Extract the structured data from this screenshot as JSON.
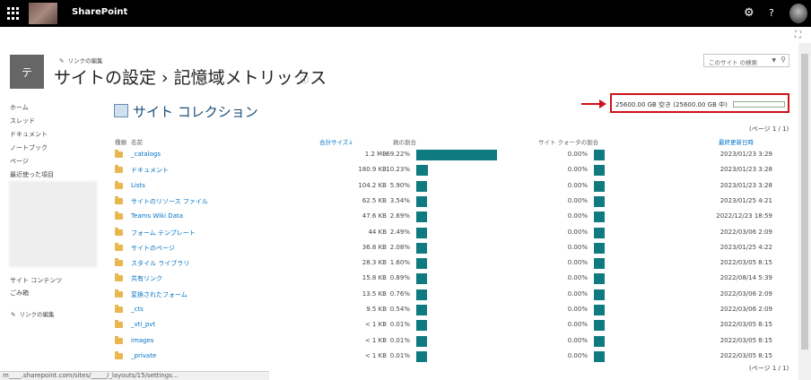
{
  "suitebar": {
    "app_title": "SharePoint",
    "icons": [
      "waffle-icon",
      "gear-icon",
      "help-icon",
      "avatar"
    ]
  },
  "header": {
    "edit_links_label": "リンクの編集",
    "logo_letter": "テ",
    "page_title": "サイトの設定 › 記憶域メトリックス",
    "search_placeholder": "このサイト の検索"
  },
  "nav": {
    "items": [
      "ホーム",
      "スレッド",
      "ドキュメント",
      "ノートブック",
      "ページ",
      "最近使った項目"
    ],
    "bottom_items": [
      "サイト コンテンツ",
      "ごみ箱"
    ],
    "edit_links_label": "リンクの編集"
  },
  "section": {
    "title": "サイト コレクション"
  },
  "quota": {
    "text": "25600.00 GB 空き (25600.00 GB 中)",
    "used_fraction": 0.0
  },
  "pager": {
    "text": "(ページ 1 / 1)"
  },
  "columns": {
    "type": "種類",
    "name": "名前",
    "total_size": "合計サイズ↓",
    "parent_pct": "親の割合",
    "quota_pct": "サイト クォータの割合",
    "modified": "最終更新日時"
  },
  "rows": [
    {
      "name": "_catalogs",
      "size": "1.2 MB",
      "pct": "69.22%",
      "pct_value": 69.22,
      "quota": "0.00%",
      "date": "2023/01/23 3:29"
    },
    {
      "name": "ドキュメント",
      "size": "180.9 KB",
      "pct": "10.23%",
      "pct_value": 10.23,
      "quota": "0.00%",
      "date": "2023/01/23 3:28"
    },
    {
      "name": "Lists",
      "size": "104.2 KB",
      "pct": "5.90%",
      "pct_value": 5.9,
      "quota": "0.00%",
      "date": "2023/01/23 3:28"
    },
    {
      "name": "サイトのリソース ファイル",
      "size": "62.5 KB",
      "pct": "3.54%",
      "pct_value": 3.54,
      "quota": "0.00%",
      "date": "2023/01/25 4:21"
    },
    {
      "name": "Teams Wiki Data",
      "size": "47.6 KB",
      "pct": "2.69%",
      "pct_value": 2.69,
      "quota": "0.00%",
      "date": "2022/12/23 18:59"
    },
    {
      "name": "フォーム テンプレート",
      "size": "44 KB",
      "pct": "2.49%",
      "pct_value": 2.49,
      "quota": "0.00%",
      "date": "2022/03/06 2:09"
    },
    {
      "name": "サイトのページ",
      "size": "36.8 KB",
      "pct": "2.08%",
      "pct_value": 2.08,
      "quota": "0.00%",
      "date": "2023/01/25 4:22"
    },
    {
      "name": "スタイル ライブラリ",
      "size": "28.3 KB",
      "pct": "1.60%",
      "pct_value": 1.6,
      "quota": "0.00%",
      "date": "2022/03/05 8:15"
    },
    {
      "name": "共有リンク",
      "size": "15.8 KB",
      "pct": "0.89%",
      "pct_value": 0.89,
      "quota": "0.00%",
      "date": "2022/08/14 5:39"
    },
    {
      "name": "変換されたフォーム",
      "size": "13.5 KB",
      "pct": "0.76%",
      "pct_value": 0.76,
      "quota": "0.00%",
      "date": "2022/03/06 2:09"
    },
    {
      "name": "_cts",
      "size": "9.5 KB",
      "pct": "0.54%",
      "pct_value": 0.54,
      "quota": "0.00%",
      "date": "2022/03/06 2:09"
    },
    {
      "name": "_vti_pvt",
      "size": "< 1 KB",
      "pct": "0.01%",
      "pct_value": 0.01,
      "quota": "0.00%",
      "date": "2022/03/05 8:15"
    },
    {
      "name": "images",
      "size": "< 1 KB",
      "pct": "0.01%",
      "pct_value": 0.01,
      "quota": "0.00%",
      "date": "2022/03/05 8:15"
    },
    {
      "name": "_private",
      "size": "< 1 KB",
      "pct": "0.01%",
      "pct_value": 0.01,
      "quota": "0.00%",
      "date": "2022/03/05 8:15"
    }
  ],
  "status": {
    "url": "m____.sharepoint.com/sites/_____/_layouts/15/settings..."
  }
}
